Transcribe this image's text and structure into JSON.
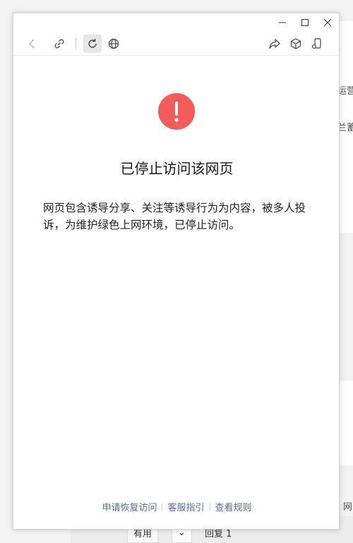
{
  "background": {
    "fragment_1": "运营",
    "fragment_2": "兰蓄",
    "fragment_3": "网",
    "bottom_button_1": "有用",
    "bottom_button_2": "⌄",
    "bottom_button_3": "回复 1"
  },
  "window": {
    "controls": [
      "minimize",
      "maximize",
      "close"
    ]
  },
  "toolbar": {
    "icons": [
      "back-icon",
      "link-icon",
      "refresh-icon",
      "globe-icon",
      "share-icon",
      "cube-icon",
      "phone-icon"
    ]
  },
  "page": {
    "title": "已停止访问该网页",
    "message": "网页包含诱导分享、关注等诱导行为为内容，被多人投诉，为维护绿色上网环境，已停止访问。",
    "alert_color": "#f45b5b"
  },
  "footer": {
    "links": [
      "申请恢复访问",
      "客服指引",
      "查看规则"
    ],
    "link_color": "#576b95"
  }
}
